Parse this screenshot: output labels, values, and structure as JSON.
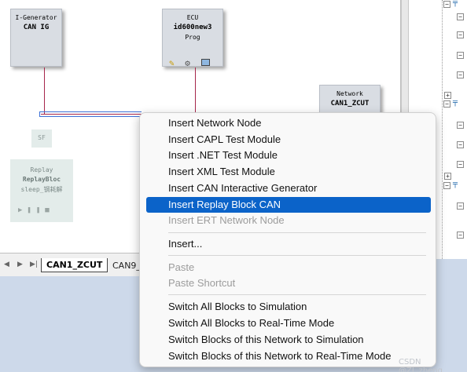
{
  "canvas": {
    "blocks": {
      "igenerator": {
        "line1": "I-Generator",
        "line2": "CAN IG"
      },
      "ecu": {
        "line1": "ECU",
        "line2": "id600new3",
        "line3": "Prog"
      },
      "network": {
        "line1": "Network",
        "line2": "CAN1_ZCUT"
      },
      "sf": {
        "label": "SF"
      },
      "replay": {
        "line1": "Replay",
        "line2": "ReplayBloc",
        "line3": "sleep_钢耗解"
      }
    },
    "colors": {
      "bus_line": "#a6264b",
      "bus_blue": "#3b6fd6",
      "block_bg": "#d9dde3",
      "lower_bg": "#cdd9ea",
      "highlight": "#0b63c9"
    }
  },
  "tabs": {
    "active": "CAN1_ZCUT",
    "other": "CAN9_"
  },
  "menu": {
    "items": [
      {
        "label": "Insert Network Node",
        "state": "normal"
      },
      {
        "label": "Insert CAPL Test Module",
        "state": "normal"
      },
      {
        "label": "Insert .NET Test Module",
        "state": "normal"
      },
      {
        "label": "Insert XML Test Module",
        "state": "normal"
      },
      {
        "label": "Insert CAN Interactive Generator",
        "state": "normal"
      },
      {
        "label": "Insert Replay Block CAN",
        "state": "highlighted"
      },
      {
        "label": "Insert ERT Network Node",
        "state": "disabled"
      },
      {
        "label": "Insert...",
        "state": "normal"
      },
      {
        "label": "Paste",
        "state": "disabled"
      },
      {
        "label": "Paste Shortcut",
        "state": "disabled"
      },
      {
        "label": "Switch All Blocks to Simulation",
        "state": "normal"
      },
      {
        "label": "Switch All Blocks to Real-Time Mode",
        "state": "normal"
      },
      {
        "label": "Switch Blocks of this Network to Simulation",
        "state": "normal"
      },
      {
        "label": "Switch Blocks of this Network to Real-Time Mode",
        "state": "normal"
      }
    ]
  },
  "watermark": "CSDN @ZL.zheng"
}
